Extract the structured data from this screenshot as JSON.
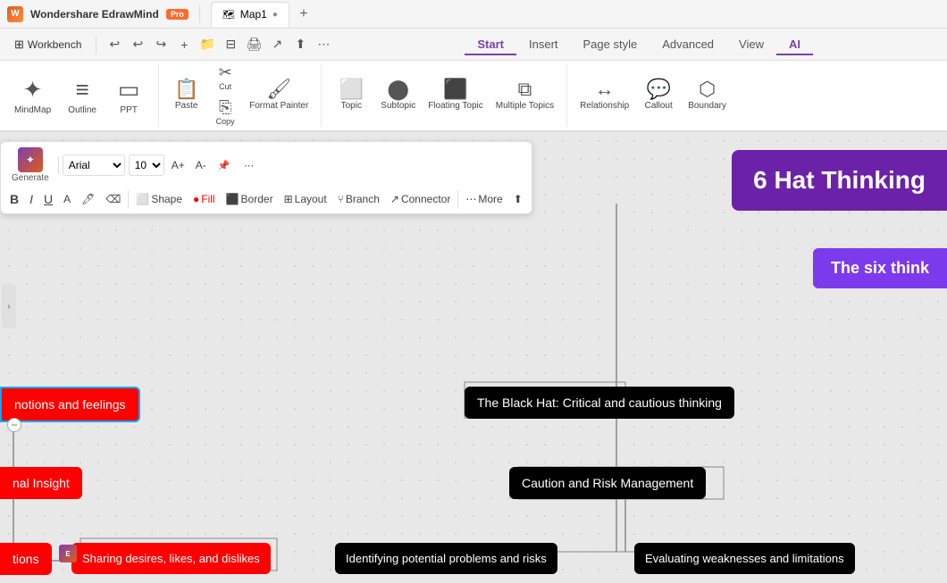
{
  "app": {
    "name": "Wondershare EdrawMind",
    "badge": "Pro",
    "tab_name": "Map1",
    "tab_dot": "●"
  },
  "menu": {
    "workbench": "Workbench",
    "tabs": [
      "Start",
      "Insert",
      "Page style",
      "Advanced",
      "View",
      "AI"
    ],
    "active_tab": "Start"
  },
  "ribbon": {
    "mindmap_label": "MindMap",
    "outline_label": "Outline",
    "ppt_label": "PPT",
    "paste_label": "Paste",
    "cut_label": "Cut",
    "copy_label": "Copy",
    "format_painter_label": "Format Painter",
    "topic_label": "Topic",
    "subtopic_label": "Subtopic",
    "floating_topic_label": "Floating Topic",
    "multiple_topics_label": "Multiple Topics",
    "relationship_label": "Relationship",
    "callout_label": "Callout",
    "boundary_label": "Boundary"
  },
  "floating_toolbar": {
    "font": "Arial",
    "size": "10",
    "generate_label": "Generate",
    "shape_label": "Shape",
    "fill_label": "Fill",
    "border_label": "Border",
    "layout_label": "Layout",
    "branch_label": "Branch",
    "connector_label": "Connector",
    "more_label": "More"
  },
  "canvas": {
    "central_node": "6 Hat Thinking",
    "sub_node": "The six think",
    "emotions_node": "notions and feelings",
    "insight_node": "nal Insight",
    "tions_node": "tions",
    "sharing_node": "Sharing desires, likes, and dislikes",
    "black_hat_node": "The Black Hat: Critical and cautious thinking",
    "caution_node": "Caution and Risk Management",
    "identifying_node": "Identifying potential problems and risks",
    "evaluating_node": "Evaluating weaknesses and limitations",
    "more_btn": "More"
  }
}
